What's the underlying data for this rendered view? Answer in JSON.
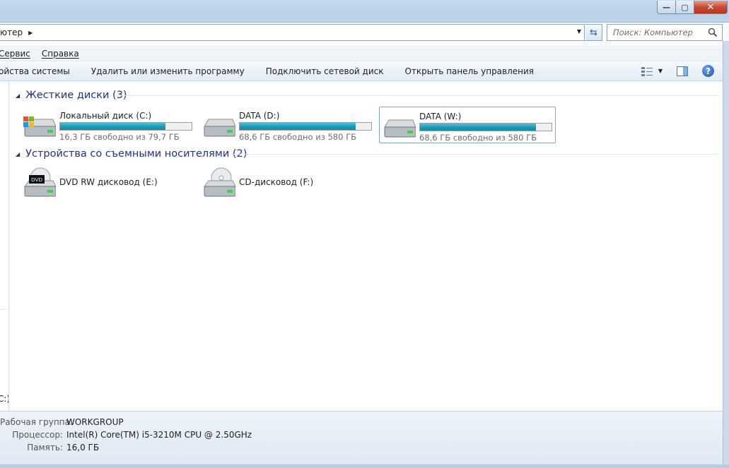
{
  "window": {
    "minimize_label": "—",
    "maximize_label": "▢",
    "close_label": "✕"
  },
  "address": {
    "crumb": "ютер",
    "search_placeholder": "Поиск: Компьютер"
  },
  "menu": {
    "items": [
      "Сервис",
      "Справка"
    ]
  },
  "commands": {
    "items": [
      "ойства системы",
      "Удалить или изменить программу",
      "Подключить сетевой диск",
      "Открыть панель управления"
    ]
  },
  "nav": {
    "visible_label": "C:)"
  },
  "groups": {
    "hard_drives": {
      "title": "Жесткие диски (3)",
      "drives": [
        {
          "name": "Локальный диск (C:)",
          "free": "16,3 ГБ свободно из 79,7 ГБ",
          "used_fraction": 0.8,
          "icon": "system-drive-icon"
        },
        {
          "name": "DATA (D:)",
          "free": "68,6 ГБ свободно из 580 ГБ",
          "used_fraction": 0.88,
          "icon": "hard-drive-icon"
        },
        {
          "name": "DATA (W:)",
          "free": "68,6 ГБ свободно из 580 ГБ",
          "used_fraction": 0.88,
          "icon": "hard-drive-icon",
          "selected": true
        }
      ]
    },
    "removable": {
      "title": "Устройства со съемными носителями (2)",
      "drives": [
        {
          "name": "DVD RW дисковод (E:)",
          "icon": "dvd-drive-icon",
          "badge": "DVD"
        },
        {
          "name": "CD-дисковод (F:)",
          "icon": "cd-drive-icon"
        }
      ]
    }
  },
  "details": {
    "workgroup_label": "Рабочая группа:",
    "workgroup_value": "WORKGROUP",
    "cpu_label": "Процессор:",
    "cpu_value": "Intel(R) Core(TM) i5-3210M CPU @ 2.50GHz",
    "memory_label": "Память:",
    "memory_value": "16,0 ГБ"
  },
  "colors": {
    "group_header": "#1e3287",
    "bar_fill": "#1d9bb6",
    "close_button": "#c74a33"
  }
}
